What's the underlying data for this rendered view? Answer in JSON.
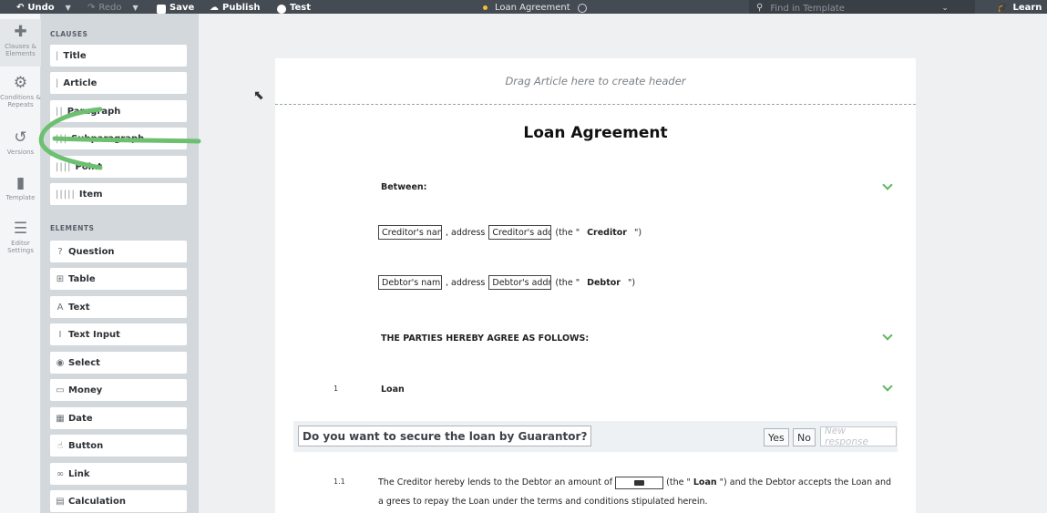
{
  "toolbar": {
    "undo": "Undo",
    "redo": "Redo",
    "save": "Save",
    "publish": "Publish",
    "test": "Test",
    "document_title": "Loan Agreement",
    "find_placeholder": "Find in Template",
    "learn": "Learn"
  },
  "rail": [
    {
      "label": "Clauses & Elements",
      "icon": "puzzle-icon"
    },
    {
      "label": "Conditions & Repeats",
      "icon": "gears-icon"
    },
    {
      "label": "Versions",
      "icon": "history-icon"
    },
    {
      "label": "Template",
      "icon": "file-icon"
    },
    {
      "label": "Editor Settings",
      "icon": "sliders-icon"
    }
  ],
  "palette": {
    "clauses_heading": "CLAUSES",
    "clauses": [
      {
        "bars": "|",
        "label": "Title"
      },
      {
        "bars": "|",
        "label": "Article"
      },
      {
        "bars": "||",
        "label": "Paragraph"
      },
      {
        "bars": "|||",
        "label": "Subparagraph"
      },
      {
        "bars": "||||",
        "label": "Point"
      },
      {
        "bars": "|||||",
        "label": "Item"
      }
    ],
    "elements_heading": "ELEMENTS",
    "elements": [
      {
        "glyph": "?",
        "label": "Question"
      },
      {
        "glyph": "⊞",
        "label": "Table"
      },
      {
        "glyph": "A",
        "label": "Text"
      },
      {
        "glyph": "I",
        "label": "Text Input"
      },
      {
        "glyph": "◉",
        "label": "Select"
      },
      {
        "glyph": "▭",
        "label": "Money"
      },
      {
        "glyph": "▦",
        "label": "Date"
      },
      {
        "glyph": "☝",
        "label": "Button"
      },
      {
        "glyph": "∞",
        "label": "Link"
      },
      {
        "glyph": "▤",
        "label": "Calculation"
      }
    ]
  },
  "document": {
    "header_placeholder": "Drag Article here to create header",
    "title": "Loan Agreement",
    "between_label": "Between:",
    "creditor": {
      "name_field": "Creditor's nan",
      "address_text": ", address",
      "address_field": "Creditor's add",
      "the_open": "(the \"",
      "role": "Creditor",
      "the_close": "\")"
    },
    "debtor": {
      "name_field": "Debtor's nam",
      "address_text": ", address",
      "address_field": "Debtor's addr",
      "the_open": "(the \"",
      "role": "Debtor",
      "the_close": "\")"
    },
    "agree_label": "THE PARTIES HEREBY AGREE AS FOLLOWS:",
    "article_number": "1",
    "article_title": "Loan",
    "question": {
      "text": "Do you want to secure the loan by Guarantor?",
      "yes": "Yes",
      "no": "No",
      "new_response": "New response"
    },
    "clause_1_1": {
      "number": "1.1",
      "part1": "The Creditor hereby lends to the Debtor an amount of",
      "part2": "(the \"",
      "loan": "Loan",
      "part3": "\") and the Debtor accepts the Loan and a grees to repay the Loan under the terms and conditions stipulated herein."
    }
  },
  "colors": {
    "toolbar_bg": "#454b52",
    "palette_bg": "#d3d8dd",
    "accent_green": "#5cb85c",
    "annotation_green": "#6cc070",
    "unsaved_dot": "#f2c230"
  }
}
